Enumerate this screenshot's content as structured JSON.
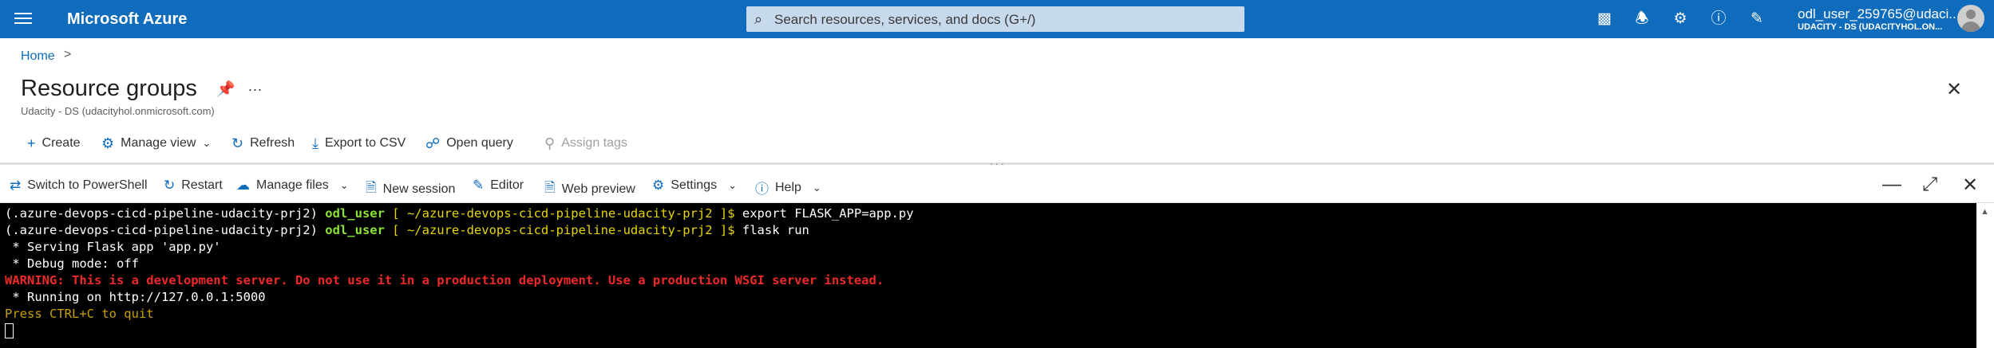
{
  "topbar": {
    "brand": "Microsoft Azure",
    "search_placeholder": "Search resources, services, and docs (G+/)",
    "icons": [
      "cloud-shell-icon",
      "bell-icon",
      "gear-icon",
      "help-icon",
      "feedback-icon"
    ],
    "user_name": "odl_user_259765@udaci...",
    "user_directory": "UDACITY - DS (UDACITYHOL.ON..."
  },
  "breadcrumb": {
    "home": "Home",
    "separator": ">"
  },
  "page": {
    "title": "Resource groups",
    "more": "...",
    "subtitle": "Udacity - DS (udacityhol.onmicrosoft.com)"
  },
  "commands": {
    "create": "Create",
    "manage_view": "Manage view",
    "refresh": "Refresh",
    "export": "Export to CSV",
    "open_query": "Open query",
    "assign_tags": "Assign tags"
  },
  "shell_toolbar": {
    "switch": "Switch to PowerShell",
    "restart": "Restart",
    "manage_files": "Manage files",
    "new_session": "New session",
    "editor": "Editor",
    "web_preview": "Web preview",
    "settings": "Settings",
    "help": "Help"
  },
  "terminal": {
    "venv": "(.azure-devops-cicd-pipeline-udacity-prj2)",
    "user": "odl_user",
    "path_open": "[ ~/azure-devops-cicd-pipeline-udacity-prj2 ]$",
    "cmd1": "export FLASK_APP=app.py",
    "cmd2": "flask run",
    "out1": " * Serving Flask app 'app.py'",
    "out2": " * Debug mode: off",
    "warning": "WARNING: This is a development server. Do not use it in a production deployment. Use a production WSGI server instead.",
    "out3": " * Running on http://127.0.0.1:5000",
    "quit": "Press CTRL+C to quit"
  },
  "colors": {
    "azure_blue": "#0f6cbd",
    "terminal_bg": "#000000",
    "prompt_green": "#8ae234",
    "prompt_yellow": "#e6d600",
    "warning_red": "#ef2929"
  }
}
